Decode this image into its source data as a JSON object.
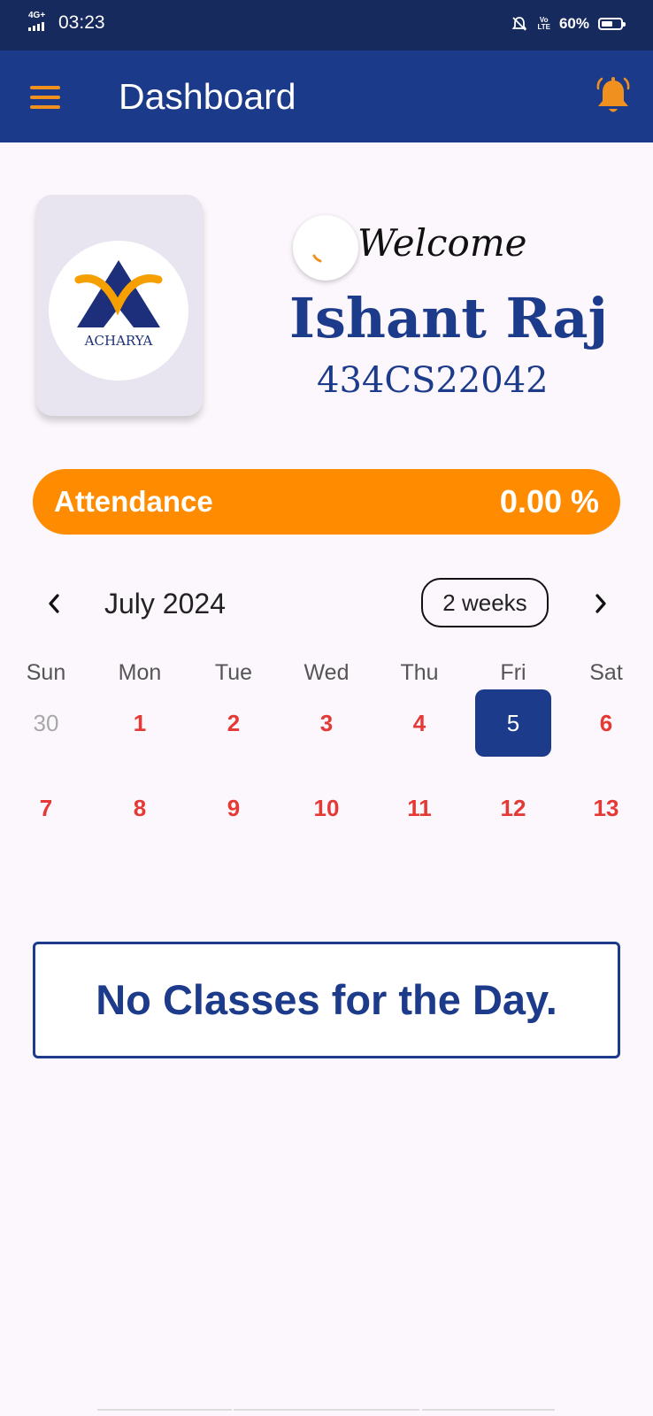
{
  "status_bar": {
    "network": "4G+",
    "time": "03:23",
    "volte_top": "Vo",
    "volte_bottom": "LTE",
    "battery": "60%",
    "battery_level": 0.6
  },
  "app_bar": {
    "title": "Dashboard",
    "menu_icon": "hamburger-menu-icon",
    "notification_icon": "bell-icon"
  },
  "profile": {
    "logo_text": "ACHARYA",
    "welcome": "Welcome",
    "name": "Ishant Raj",
    "usn": "434CS22042"
  },
  "attendance": {
    "label": "Attendance",
    "value": "0.00 %"
  },
  "calendar": {
    "month": "July 2024",
    "format_button": "2 weeks",
    "weekdays": [
      "Sun",
      "Mon",
      "Tue",
      "Wed",
      "Thu",
      "Fri",
      "Sat"
    ],
    "weeks": [
      [
        "30",
        "1",
        "2",
        "3",
        "4",
        "5",
        "6"
      ],
      [
        "7",
        "8",
        "9",
        "10",
        "11",
        "12",
        "13"
      ]
    ],
    "selected_day": "5"
  },
  "schedule": {
    "empty_message": "No Classes for the Day."
  },
  "colors": {
    "primary": "#1c3a8a",
    "accent": "#ff8c00",
    "day_text": "#e53935",
    "status_bar": "#172a5e"
  }
}
